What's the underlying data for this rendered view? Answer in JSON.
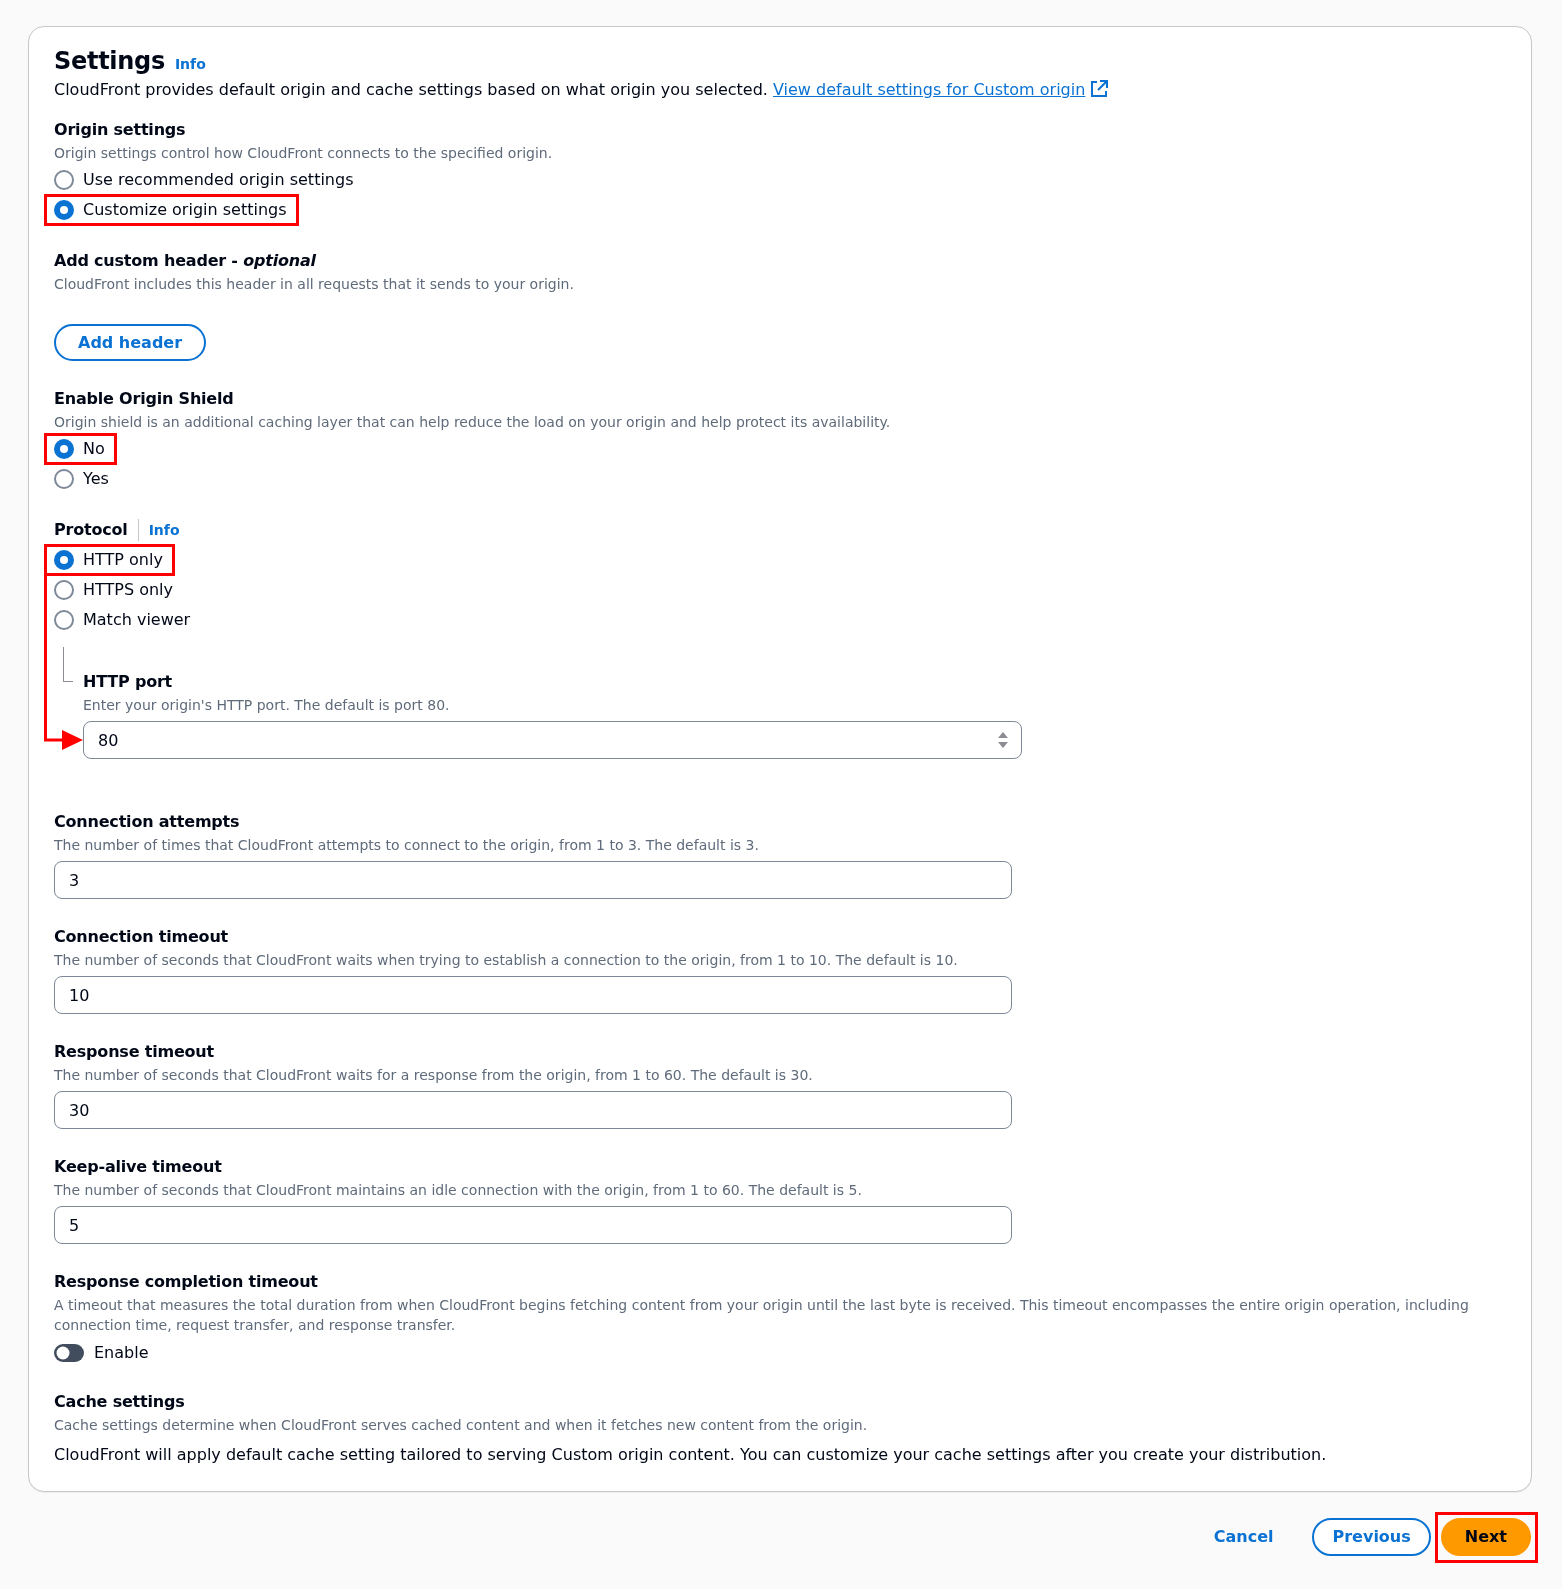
{
  "settings": {
    "title": "Settings",
    "info": "Info",
    "description": "CloudFront provides default origin and cache settings based on what origin you selected.",
    "link": "View default settings for Custom origin"
  },
  "sections": [
    {
      "kind": "radio",
      "title": "Origin settings",
      "description": "Origin settings control how CloudFront connects to the specified origin.",
      "options": [
        {
          "label": "Use recommended origin settings",
          "selected": false,
          "highlighted": false
        },
        {
          "label": "Customize origin settings",
          "selected": true,
          "highlighted": true
        }
      ]
    },
    {
      "kind": "button",
      "title": "Add custom header - *optional*",
      "description": "CloudFront includes this header in all requests that it sends to your origin.",
      "button": "Add header"
    },
    {
      "kind": "radio",
      "title": "Enable Origin Shield",
      "description": "Origin shield is an additional caching layer that can help reduce the load on your origin and help protect its availability.",
      "options": [
        {
          "label": "No",
          "selected": true,
          "highlighted": true
        },
        {
          "label": "Yes",
          "selected": false,
          "highlighted": false
        }
      ]
    },
    {
      "kind": "radio",
      "title": "Protocol",
      "info": "Info",
      "options": [
        {
          "label": "HTTP only",
          "selected": true,
          "highlighted": true
        },
        {
          "label": "HTTPS only",
          "selected": false,
          "highlighted": false
        },
        {
          "label": "Match viewer",
          "selected": false,
          "highlighted": false
        }
      ],
      "port": {
        "label": "HTTP port",
        "description": "Enter your origin's HTTP port. The default is port 80.",
        "value": "80",
        "arrow": true
      }
    },
    {
      "kind": "input",
      "title": "Connection attempts",
      "description": "The number of times that CloudFront attempts to connect to the origin, from 1 to 3. The default is 3.",
      "value": "3"
    },
    {
      "kind": "input",
      "title": "Connection timeout",
      "description": "The number of seconds that CloudFront waits when trying to establish a connection to the origin, from 1 to 10. The default is 10.",
      "value": "10"
    },
    {
      "kind": "input",
      "title": "Response timeout",
      "description": "The number of seconds that CloudFront waits for a response from the origin, from 1 to 60. The default is 30.",
      "value": "30"
    },
    {
      "kind": "input",
      "title": "Keep-alive timeout",
      "description": "The number of seconds that CloudFront maintains an idle connection with the origin, from 1 to 60. The default is 5.",
      "value": "5"
    },
    {
      "kind": "toggle",
      "title": "Response completion timeout",
      "description": "A timeout that measures the total duration from when CloudFront begins fetching content from your origin until the last byte is received. This timeout encompasses the entire origin operation, including connection time, request transfer, and response transfer.",
      "toggle": {
        "label": "Enable",
        "on": false
      }
    },
    {
      "kind": "text",
      "title": "Cache settings",
      "description": "Cache settings determine when CloudFront serves cached content and when it fetches new content from the origin.",
      "text": "CloudFront will apply default cache setting tailored to serving Custom origin content. You can customize your cache settings after you create your distribution."
    }
  ],
  "footer": {
    "buttons": [
      {
        "label": "Cancel",
        "kind": "link",
        "highlighted": false
      },
      {
        "label": "Previous",
        "kind": "secondary",
        "highlighted": false
      },
      {
        "label": "Next",
        "kind": "primary",
        "highlighted": true
      }
    ]
  }
}
